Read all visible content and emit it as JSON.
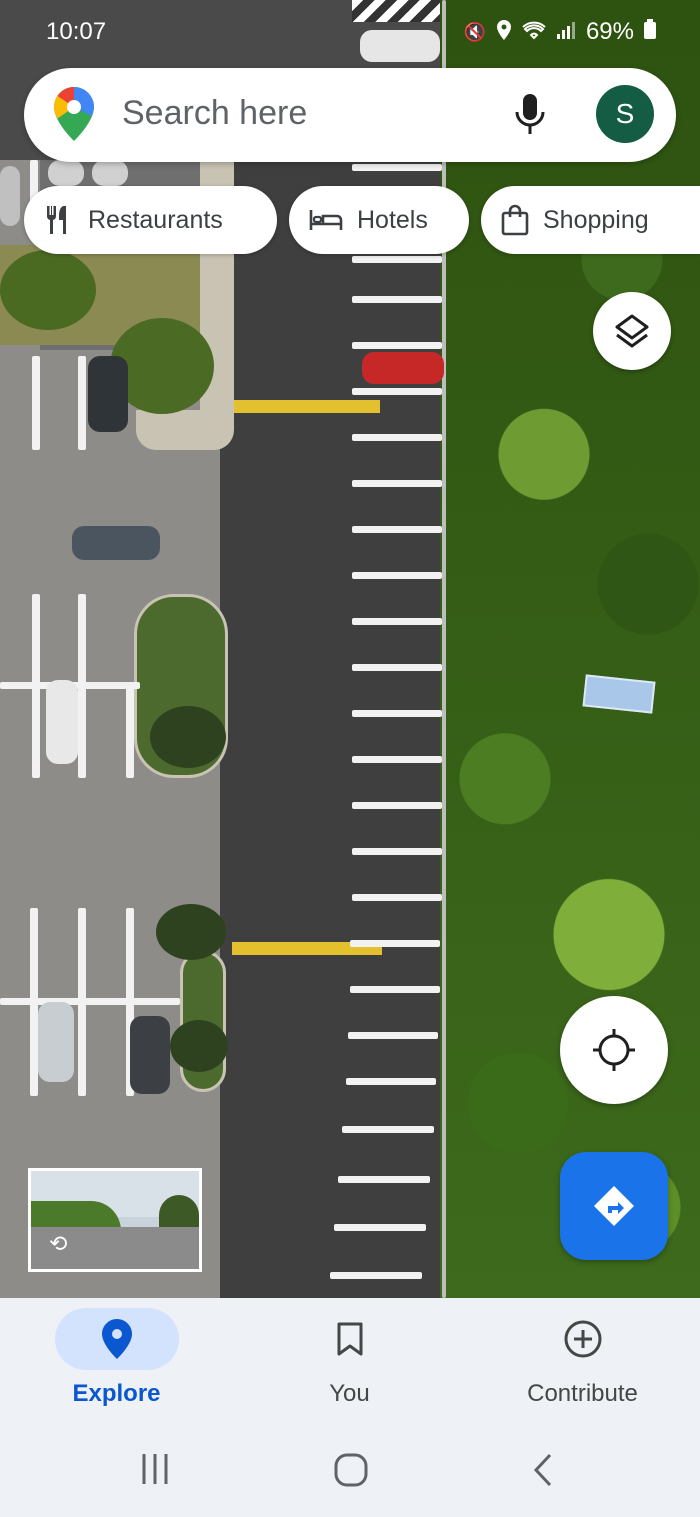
{
  "status_bar": {
    "time": "10:07",
    "battery": "69%",
    "icons": [
      "mute-icon",
      "location-icon",
      "wifi-icon",
      "signal-icon",
      "battery-icon"
    ]
  },
  "search": {
    "placeholder": "Search here",
    "avatar_letter": "S"
  },
  "chips": [
    {
      "label": "Restaurants",
      "icon": "fork-knife-icon"
    },
    {
      "label": "Hotels",
      "icon": "bed-icon"
    },
    {
      "label": "Shopping",
      "icon": "shopping-bag-icon"
    }
  ],
  "map": {
    "type": "satellite",
    "controls": [
      "layers-icon",
      "my-location-icon",
      "directions-icon"
    ]
  },
  "bottom_nav": {
    "tabs": [
      {
        "label": "Explore",
        "icon": "explore-pin-icon",
        "active": true
      },
      {
        "label": "You",
        "icon": "bookmark-icon",
        "active": false
      },
      {
        "label": "Contribute",
        "icon": "add-circle-icon",
        "active": false
      }
    ]
  },
  "colors": {
    "accent": "#1a73e8",
    "active_tab_bg": "#d3e3fd",
    "active_tab_text": "#0b57d0",
    "avatar_bg": "#145c44"
  }
}
